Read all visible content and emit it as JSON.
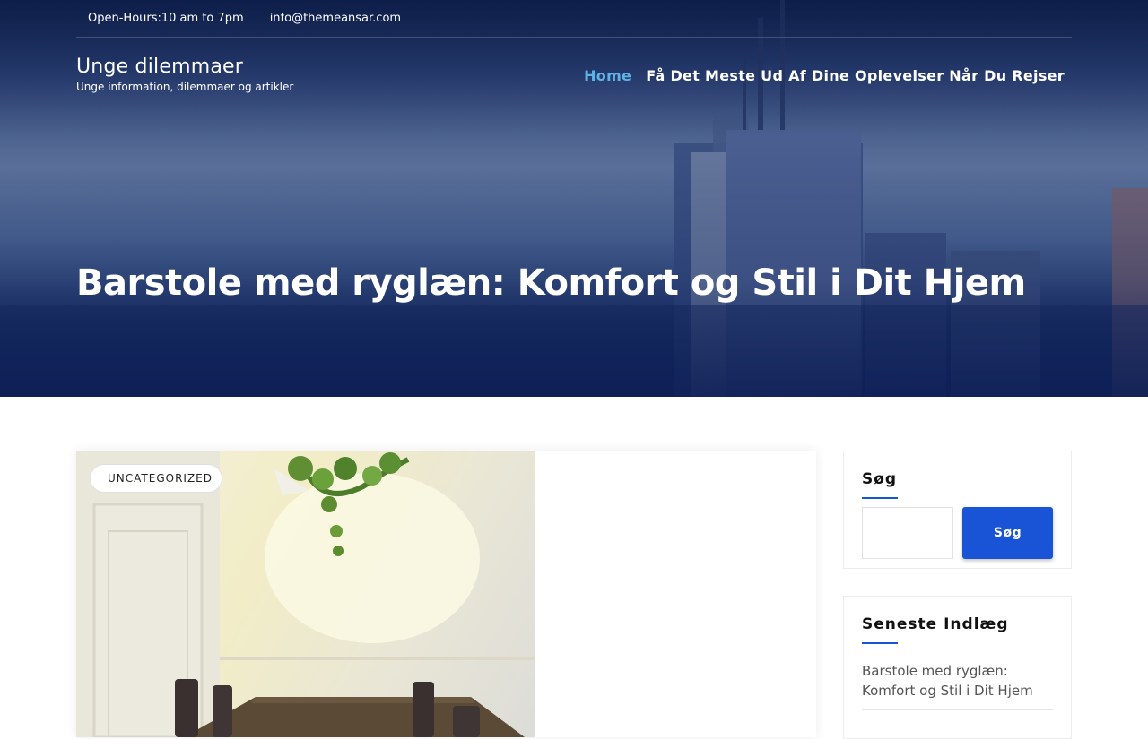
{
  "topbar": {
    "hours": "Open-Hours:10 am to 7pm",
    "email": "info@themeansar.com"
  },
  "site": {
    "title": "Unge dilemmaer",
    "tagline": "Unge information, dilemmaer og artikler"
  },
  "nav": {
    "items": [
      {
        "label": "Home",
        "active": true
      },
      {
        "label": "Få Det Meste Ud Af Dine Oplevelser Når Du Rejser",
        "active": false
      }
    ]
  },
  "page": {
    "title": "Barstole med ryglæn: Komfort og Stil i Dit Hjem"
  },
  "post": {
    "category": "UNCATEGORIZED"
  },
  "sidebar": {
    "search": {
      "title": "Søg",
      "button_label": "Søg",
      "placeholder": ""
    },
    "recent": {
      "title": "Seneste Indlæg",
      "items": [
        "Barstole med ryglæn: Komfort og Stil i Dit Hjem"
      ]
    }
  },
  "colors": {
    "accent": "#1a54d6",
    "nav_active": "#5fb2e6",
    "hero_dark": "#0f2156"
  }
}
